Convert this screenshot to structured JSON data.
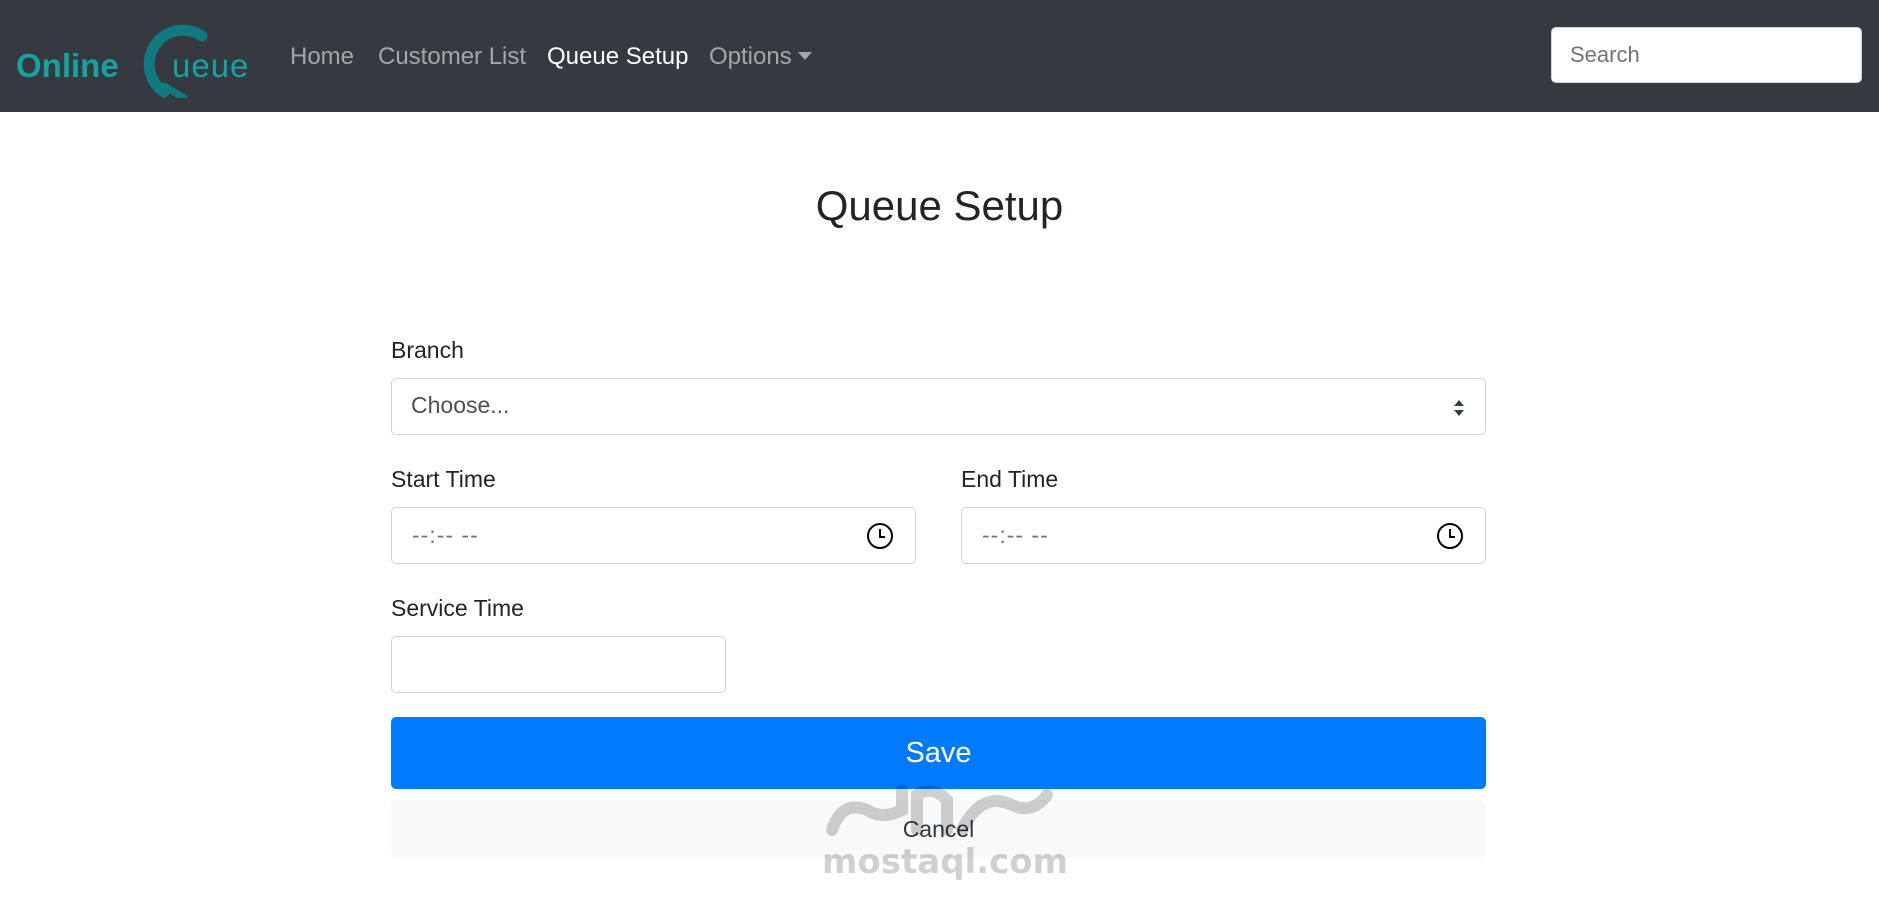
{
  "brand": {
    "text_left": "Online",
    "text_right": "ueue",
    "color_teal": "#17a2a2",
    "color_dark_teal": "#117a80"
  },
  "nav": {
    "items": [
      {
        "label": "Home"
      },
      {
        "label": "Customer List"
      },
      {
        "label": "Queue Setup"
      },
      {
        "label": "Options"
      }
    ],
    "active": "Queue Setup"
  },
  "search": {
    "placeholder": "Search"
  },
  "page": {
    "title": "Queue Setup"
  },
  "form": {
    "branch": {
      "label": "Branch",
      "value": "Choose..."
    },
    "start_time": {
      "label": "Start Time",
      "value": "--:-- --"
    },
    "end_time": {
      "label": "End Time",
      "value": "--:-- --"
    },
    "service_time": {
      "label": "Service Time",
      "value": ""
    },
    "save_label": "Save",
    "cancel_label": "Cancel"
  },
  "watermark": {
    "text": "mostaql.com"
  },
  "colors": {
    "navbar": "#343a40",
    "primary": "#007bff",
    "light": "#f8f9fa"
  }
}
